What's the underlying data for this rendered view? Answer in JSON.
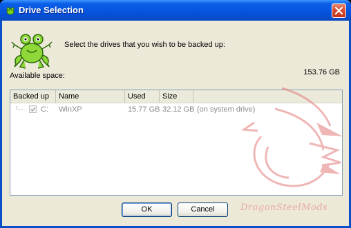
{
  "window": {
    "title": "Drive Selection"
  },
  "dialog": {
    "prompt": "Select the drives that you wish to be backed up:",
    "available_space_label": "Available space:",
    "available_space_value": "153.76 GB"
  },
  "table": {
    "columns": [
      "Backed up",
      "Name",
      "Used",
      "Size"
    ],
    "rows": [
      {
        "backed_up": true,
        "drive": "C:",
        "name": "WinXP",
        "used": "15.77 GB",
        "size": "32.12 GB",
        "note": "(on system drive)"
      }
    ]
  },
  "buttons": {
    "ok": "OK",
    "cancel": "Cancel"
  },
  "watermark": "DragonSteelMods",
  "icons": {
    "app": "frog-icon",
    "close": "close-icon"
  },
  "colors": {
    "titlebar": "#0553df",
    "client": "#ece9d8",
    "disabled_text": "#8a8a8a",
    "close_button": "#d8472a"
  }
}
